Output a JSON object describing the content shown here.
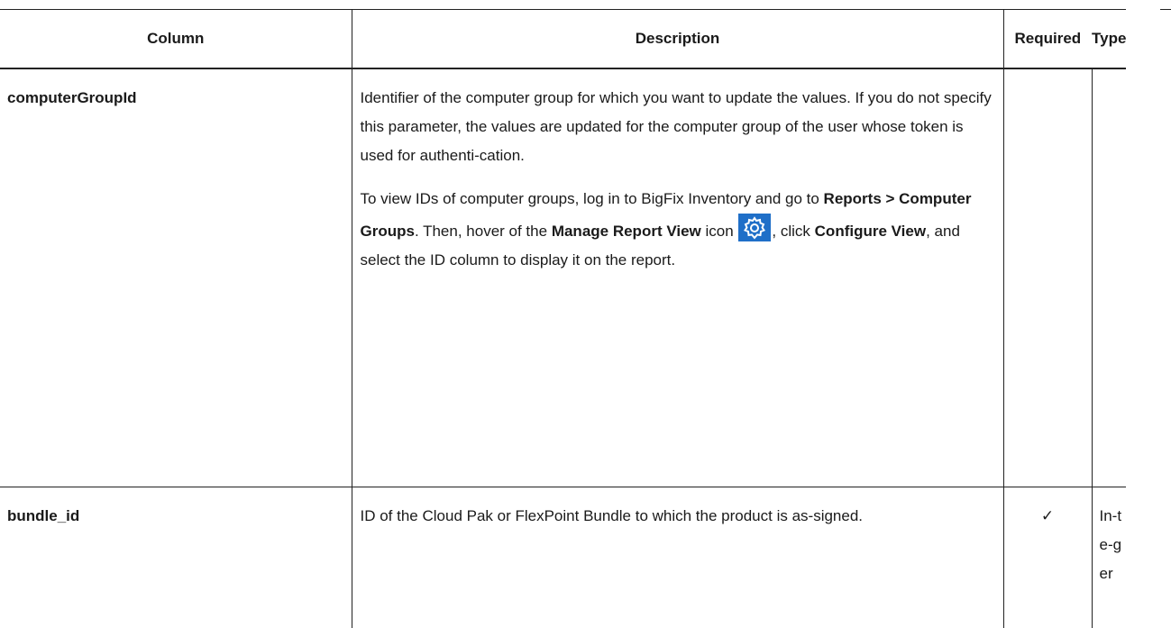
{
  "headers": {
    "column": "Column",
    "description": "Description",
    "required": "Required",
    "type": "Type"
  },
  "rows": [
    {
      "name": "computerGroupId",
      "desc_p1": "Identifier of the computer group for which you want to update the values. If you do not specify this parameter, the values are updated for the computer group of the user whose token is used for authenti-cation.",
      "desc_p2_pre": "To view IDs of computer groups, log in to BigFix Inventory and go to",
      "desc_p2_b1": "Reports > Computer Groups",
      "desc_p2_mid1": ". Then, hover of the",
      "desc_p2_b2": "Manage Report View",
      "desc_p2_mid2": "icon",
      "desc_p2_mid3": ", click",
      "desc_p2_b3": "Configure View",
      "desc_p2_post": ", and select the ID column to display it on the report.",
      "required": "",
      "type": ""
    },
    {
      "name": "bundle_id",
      "desc_p1": "ID of the Cloud Pak or FlexPoint Bundle to which the product is as-signed.",
      "required": "✓",
      "type": "In-te-ger"
    }
  ],
  "icons": {
    "manage_view": "gear-icon"
  },
  "colors": {
    "icon_bg": "#1f6fc8"
  }
}
